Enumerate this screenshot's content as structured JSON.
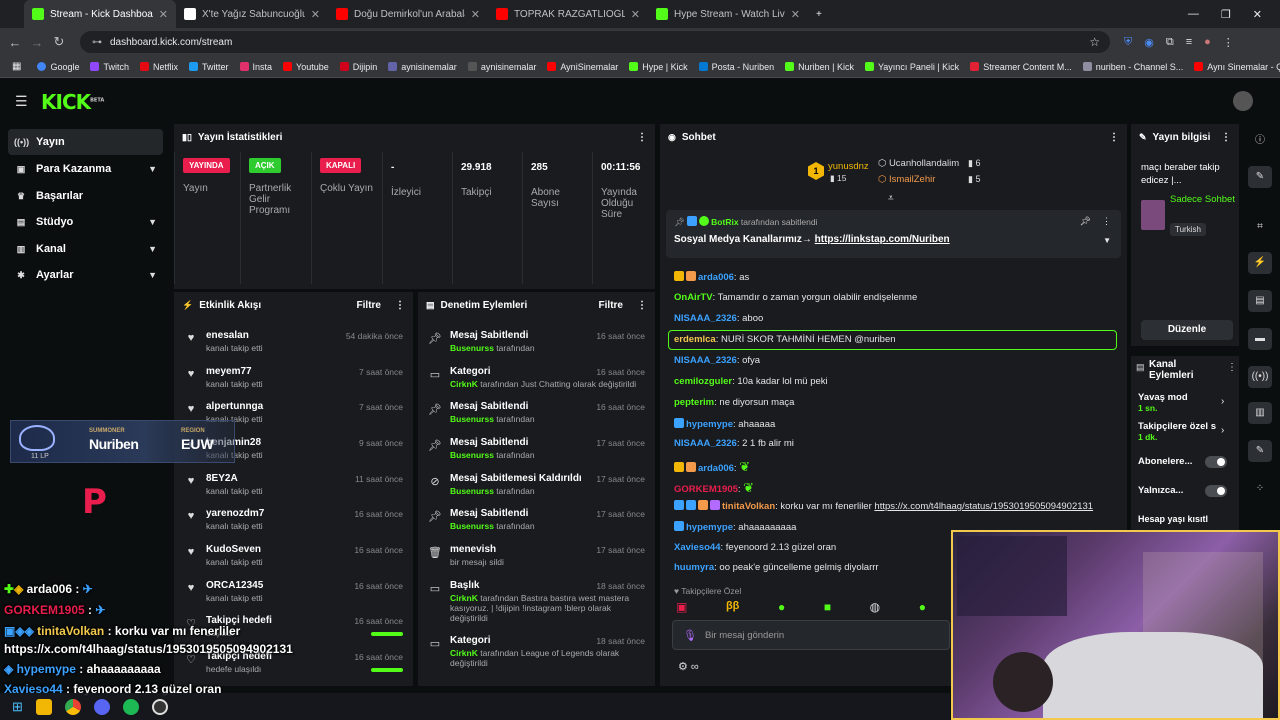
{
  "browser": {
    "tabs": [
      {
        "title": "Stream - Kick Dashboard",
        "color": "#53fc18"
      },
      {
        "title": "X'te Yağız Sabuncuoğlu: \"ÖZEL",
        "color": "#000000"
      },
      {
        "title": "Doğu Demirkol'un Arabaları! | ...",
        "color": "#ff0000"
      },
      {
        "title": "TOPRAK RAZGATLIOĞLU PİST 2",
        "color": "#ff0000"
      },
      {
        "title": "Hype Stream - Watch Live on K...",
        "color": "#53fc18"
      }
    ],
    "url": "dashboard.kick.com/stream",
    "bookmarks": [
      {
        "label": "Google",
        "color": "#4285f4"
      },
      {
        "label": "Twitch",
        "color": "#9146ff"
      },
      {
        "label": "Netflix",
        "color": "#e50914"
      },
      {
        "label": "Twitter",
        "color": "#1d9bf0"
      },
      {
        "label": "Insta",
        "color": "#e1306c"
      },
      {
        "label": "Youtube",
        "color": "#ff0000"
      },
      {
        "label": "Dijipin",
        "color": "#d0021b"
      },
      {
        "label": "aynisinemalar",
        "color": "#6264a7"
      },
      {
        "label": "aynisinemalar",
        "color": "#444444"
      },
      {
        "label": "AyniSinemalar",
        "color": "#ff0000"
      },
      {
        "label": "Hype | Kick",
        "color": "#53fc18"
      },
      {
        "label": "Posta - Nuriben",
        "color": "#0078d4"
      },
      {
        "label": "Nuriben | Kick",
        "color": "#53fc18"
      },
      {
        "label": "Yayıncı Paneli | Kick",
        "color": "#53fc18"
      },
      {
        "label": "Streamer Content M...",
        "color": "#e22134"
      },
      {
        "label": "nuriben - Channel S...",
        "color": "#8e8ea0"
      },
      {
        "label": "Aynı Sinemalar - Ça...",
        "color": "#ff0000"
      }
    ]
  },
  "kick": {
    "logo": "KICK",
    "logo_sup": "BETA"
  },
  "sidebar": {
    "items": [
      {
        "label": "Yayın",
        "icon": "broadcast-icon"
      },
      {
        "label": "Para Kazanma",
        "icon": "wallet-icon"
      },
      {
        "label": "Başarılar",
        "icon": "trophy-icon"
      },
      {
        "label": "Stüdyo",
        "icon": "studio-icon"
      },
      {
        "label": "Kanal",
        "icon": "channel-icon"
      },
      {
        "label": "Ayarlar",
        "icon": "gear-icon"
      }
    ]
  },
  "stats": {
    "title": "Yayın İstatistikleri",
    "cells": [
      {
        "pill": "YAYINDA",
        "pill_color": "#e91e4d",
        "label": "Yayın"
      },
      {
        "pill": "AÇIK",
        "pill_color": "#2ecc2e",
        "label": "Partnerlik Gelir Programı"
      },
      {
        "pill": "KAPALI",
        "pill_color": "#e91e4d",
        "label": "Çoklu Yayın"
      },
      {
        "value": "-",
        "label": "İzleyici"
      },
      {
        "value": "29.918",
        "label": "Takipçi"
      },
      {
        "value": "285",
        "label": "Abone Sayısı"
      },
      {
        "value": "00:11:56",
        "label": "Yayında Olduğu Süre"
      }
    ]
  },
  "activity": {
    "title": "Etkinlik Akışı",
    "filter": "Filtre",
    "items": [
      {
        "name": "enesalan",
        "sub": "kanalı takip etti",
        "time": "54 dakika önce"
      },
      {
        "name": "meyem77",
        "sub": "kanalı takip etti",
        "time": "7 saat önce"
      },
      {
        "name": "alpertunnga",
        "sub": "kanalı takip etti",
        "time": "7 saat önce"
      },
      {
        "name": "benjamin28",
        "sub": "kanalı takip etti",
        "time": "9 saat önce"
      },
      {
        "name": "8EY2A",
        "sub": "kanalı takip etti",
        "time": "11 saat önce"
      },
      {
        "name": "yarenozdm7",
        "sub": "kanalı takip etti",
        "time": "16 saat önce"
      },
      {
        "name": "KudoSeven",
        "sub": "kanalı takip etti",
        "time": "16 saat önce"
      },
      {
        "name": "ORCA12345",
        "sub": "kanalı takip etti",
        "time": "16 saat önce"
      },
      {
        "name": "Takipçi hedefi",
        "sub": "başladı",
        "time": "16 saat önce"
      },
      {
        "name": "Takipçi hedefi",
        "sub": "hedefe ulaşıldı",
        "time": "16 saat önce"
      }
    ]
  },
  "moderation": {
    "title": "Denetim Eylemleri",
    "filter": "Filtre",
    "items": [
      {
        "icon": "pin-icon",
        "title": "Mesaj Sabitlendi",
        "user": "Busenurss",
        "rest": " tarafından",
        "time": "16 saat önce"
      },
      {
        "icon": "category-icon",
        "title": "Kategori",
        "user": "CirknK",
        "rest": " tarafından Just Chatting olarak değiştirildi",
        "time": "16 saat önce"
      },
      {
        "icon": "pin-icon",
        "title": "Mesaj Sabitlendi",
        "user": "Busenurss",
        "rest": " tarafından",
        "time": "16 saat önce"
      },
      {
        "icon": "pin-icon",
        "title": "Mesaj Sabitlendi",
        "user": "Busenurss",
        "rest": " tarafından",
        "time": "17 saat önce"
      },
      {
        "icon": "unpin-icon",
        "title": "Mesaj Sabitlemesi Kaldırıldı",
        "user": "Busenurss",
        "rest": " tarafından",
        "time": "17 saat önce"
      },
      {
        "icon": "pin-icon",
        "title": "Mesaj Sabitlendi",
        "user": "Busenurss",
        "rest": " tarafından",
        "time": "17 saat önce"
      },
      {
        "icon": "trash-icon",
        "title": "menevish",
        "user": "",
        "rest": "bir mesajı sildi",
        "time": "17 saat önce"
      },
      {
        "icon": "title-icon",
        "title": "Başlık",
        "user": "CirknK",
        "rest": " tarafından Bastıra bastıra west mastera kasıyoruz. | !dijipin !instagram !blerp olarak değiştirildi",
        "time": "18 saat önce"
      },
      {
        "icon": "category-icon",
        "title": "Kategori",
        "user": "CirknK",
        "rest": " tarafından League of Legends olarak değiştirildi",
        "time": "18 saat önce"
      }
    ]
  },
  "chat": {
    "title": "Sohbet",
    "top_gifters": [
      {
        "name": "yunusdnz",
        "count": "15",
        "rank": "1"
      },
      {
        "name": "Ucanhollandalim",
        "count": "6"
      },
      {
        "name": "IsmailZehir",
        "count": "5"
      }
    ],
    "pinned": {
      "author": "BotRix",
      "by": "tarafından sabitlendi",
      "text": "Sosyal Medya Kanallarımız→ ",
      "link": "https://linkstap.com/Nuriben"
    },
    "messages": [
      {
        "user": "arda006",
        "color": "#3ca2ff",
        "text": "as"
      },
      {
        "user": "OnAirTV",
        "color": "#53fc18",
        "text": "Tamamdır o zaman yorgun olabilir endişelenme"
      },
      {
        "user": "NISAAA_2326",
        "color": "#3ca2ff",
        "text": "aboo"
      },
      {
        "user": "erdemlca",
        "color": "#f2c94c",
        "text": "NURİ SKOR TAHMİNİ HEMEN @nuriben"
      },
      {
        "user": "NISAAA_2326",
        "color": "#3ca2ff",
        "text": "ofya"
      },
      {
        "user": "cemilozguler",
        "color": "#53fc18",
        "text": "10a kadar lol mü peki"
      },
      {
        "user": "pepterim",
        "color": "#53fc18",
        "text": "ne diyorsun maça"
      },
      {
        "user": "hypemype",
        "color": "#3ca2ff",
        "text": "ahaaaaa"
      },
      {
        "user": "NISAAA_2326",
        "color": "#3ca2ff",
        "text": "2 1 fb alir mi"
      },
      {
        "user": "arda006",
        "color": "#3ca2ff",
        "text": ""
      },
      {
        "user": "GORKEM1905",
        "color": "#e91e4d",
        "text": ""
      },
      {
        "user": "tinitaVolkan",
        "color": "#f2994a",
        "text": "korku var mı fenerliler ",
        "link": "https://x.com/t4lhaag/status/1953019505094902131"
      },
      {
        "user": "hypemype",
        "color": "#3ca2ff",
        "text": "ahaaaaaaaaa"
      },
      {
        "user": "Xavieso44",
        "color": "#3ca2ff",
        "text": "feyenoord 2.13 güzel oran"
      },
      {
        "user": "huumyra",
        "color": "#3ca2ff",
        "text": "oo peak'e güncelleme gelmiş diyolarrr"
      }
    ],
    "followers_label": "Takipçilere Özel",
    "input_placeholder": "Bir mesaj gönderin"
  },
  "stream_info": {
    "title": "Yayın bilgisi",
    "stream_title": "maçı beraber takip edicez |...",
    "mode": "Sadece Sohbet",
    "language": "Turkish",
    "edit": "Düzenle"
  },
  "channel_actions": {
    "title": "Kanal Eylemleri",
    "items": [
      {
        "label": "Yavaş mod",
        "sub": "1 sn."
      },
      {
        "label": "Takipçilere özel s",
        "sub": "1 dk."
      },
      {
        "label": "Abonelere..."
      },
      {
        "label": "Yalnızca..."
      },
      {
        "label": "Hesap yaşı kısıtl"
      }
    ]
  },
  "overlay": {
    "summoner_label": "SUMMONER",
    "summoner": "Nuriben",
    "region_label": "REGION",
    "region": "EUW",
    "lp": "11 LP",
    "chat": [
      {
        "user": "arda006",
        "color": "#ffffff",
        "text": " :"
      },
      {
        "user": "GORKEM1905",
        "color": "#e91e4d",
        "text": " :"
      },
      {
        "user": "tinitaVolkan",
        "color": "#f2c94c",
        "text": " : korku var mı fenerliler"
      },
      {
        "user": "",
        "color": "#ffffff",
        "text": "https://x.com/t4lhaag/status/1953019505094902131"
      },
      {
        "user": "hypemype",
        "color": "#3ca2ff",
        "text": " : ahaaaaaaaaa"
      },
      {
        "user": "Xavieso44",
        "color": "#3ca2ff",
        "text": " : feyenoord 2.13 güzel oran"
      }
    ]
  }
}
